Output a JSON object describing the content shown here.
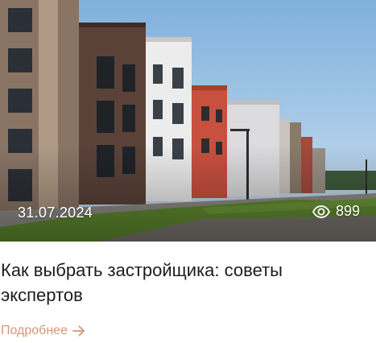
{
  "card": {
    "date": "31.07.2024",
    "views": "899",
    "title": "Как выбрать застройщика: советы экспертов",
    "more_label": "Подробнее"
  },
  "icons": {
    "views": "eye-icon",
    "more": "arrow-right-icon"
  },
  "colors": {
    "accent": "#d4957a",
    "title_text": "#1c1c1c",
    "overlay_text": "#ffffff"
  }
}
